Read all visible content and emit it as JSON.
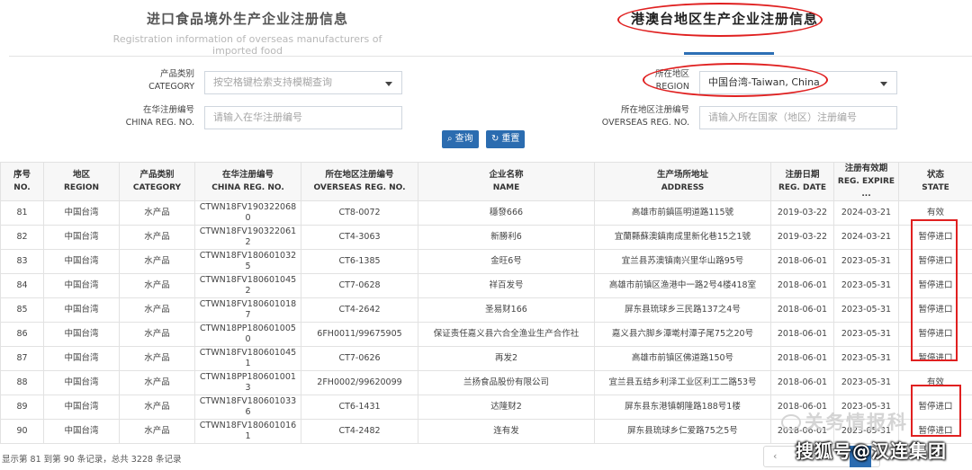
{
  "tabs": {
    "left": {
      "title": "进口食品境外生产企业注册信息",
      "subtitle": "Registration information of overseas manufacturers of imported food"
    },
    "right": {
      "title": "港澳台地区生产企业注册信息"
    }
  },
  "filters": {
    "category": {
      "label_cn": "产品类别",
      "label_en": "CATEGORY",
      "placeholder": "按空格键检索支持模糊查询"
    },
    "region": {
      "label_cn": "所在地区",
      "label_en": "REGION",
      "value": "中国台湾-Taiwan, China"
    },
    "china_reg": {
      "label_cn": "在华注册编号",
      "label_en": "CHINA REG. NO.",
      "placeholder": "请输入在华注册编号"
    },
    "overseas_reg": {
      "label_cn": "所在地区注册编号",
      "label_en": "OVERSEAS REG. NO.",
      "placeholder": "请输入所在国家（地区）注册编号"
    }
  },
  "buttons": {
    "search": "查询",
    "reset": "重置"
  },
  "table": {
    "headers": [
      {
        "cn": "序号",
        "en": "NO."
      },
      {
        "cn": "地区",
        "en": "REGION"
      },
      {
        "cn": "产品类别",
        "en": "CATEGORY"
      },
      {
        "cn": "在华注册编号",
        "en": "CHINA REG. NO."
      },
      {
        "cn": "所在地区注册编号",
        "en": "OVERSEAS REG. NO."
      },
      {
        "cn": "企业名称",
        "en": "NAME"
      },
      {
        "cn": "生产场所地址",
        "en": "ADDRESS"
      },
      {
        "cn": "注册日期",
        "en": "REG. DATE"
      },
      {
        "cn": "注册有效期",
        "en": "REG. EXPIRE ..."
      },
      {
        "cn": "状态",
        "en": "STATE"
      }
    ],
    "rows": [
      [
        "81",
        "中国台湾",
        "水产品",
        "CTWN18FV1903220680",
        "CT8-0072",
        "穩發666",
        "高雄市前鎮區明道路115號",
        "2019-03-22",
        "2024-03-21",
        "有效"
      ],
      [
        "82",
        "中国台湾",
        "水产品",
        "CTWN18FV1903220612",
        "CT4-3063",
        "新勝利6",
        "宜蘭縣蘇澳鎮南成里新化巷15之1號",
        "2019-03-22",
        "2024-03-21",
        "暂停进口"
      ],
      [
        "83",
        "中国台湾",
        "水产品",
        "CTWN18FV1806010325",
        "CT6-1385",
        "金旺6号",
        "宜兰县苏澳镇南兴里华山路95号",
        "2018-06-01",
        "2023-05-31",
        "暂停进口"
      ],
      [
        "84",
        "中国台湾",
        "水产品",
        "CTWN18FV1806010452",
        "CT7-0628",
        "祥百发号",
        "高雄市前镇区渔港中一路2号4楼418室",
        "2018-06-01",
        "2023-05-31",
        "暂停进口"
      ],
      [
        "85",
        "中国台湾",
        "水产品",
        "CTWN18FV1806010187",
        "CT4-2642",
        "圣易财166",
        "屏东县琉球乡三民路137之4号",
        "2018-06-01",
        "2023-05-31",
        "暂停进口"
      ],
      [
        "86",
        "中国台湾",
        "水产品",
        "CTWN18PP1806010050",
        "6FH0011/99675905",
        "保证责任嘉义县六合全渔业生产合作社",
        "嘉义县六脚乡潭墘村潭子尾75之20号",
        "2018-06-01",
        "2023-05-31",
        "暂停进口"
      ],
      [
        "87",
        "中国台湾",
        "水产品",
        "CTWN18FV1806010451",
        "CT7-0626",
        "再发2",
        "高雄市前镇区佛道路150号",
        "2018-06-01",
        "2023-05-31",
        "暂停进口"
      ],
      [
        "88",
        "中国台湾",
        "水产品",
        "CTWN18PP1806010013",
        "2FH0002/99620099",
        "兰扬食品股份有限公司",
        "宜兰县五结乡利泽工业区利工二路53号",
        "2018-06-01",
        "2023-05-31",
        "有效"
      ],
      [
        "89",
        "中国台湾",
        "水产品",
        "CTWN18FV1806010336",
        "CT6-1431",
        "达隆财2",
        "屏东县东港镇朝隆路188号1楼",
        "2018-06-01",
        "2023-05-31",
        "暂停进口"
      ],
      [
        "90",
        "中国台湾",
        "水产品",
        "CTWN18FV1806010161",
        "CT4-2482",
        "连有发",
        "屏东县琉球乡仁爱路75之5号",
        "2018-06-01",
        "2023-05-31",
        "暂停进口"
      ]
    ]
  },
  "footer": {
    "summary": "显示第 81 到第 90 条记录，总共 3228 条记录"
  },
  "watermarks": {
    "wechat": "关务情报科",
    "sohu": "搜狐号@汉连集团"
  },
  "colors": {
    "accent": "#2b6cb0",
    "highlight": "#e02020"
  },
  "icons": {
    "search": "search-icon",
    "reset": "refresh-icon",
    "dropdown": "caret-down-icon"
  }
}
